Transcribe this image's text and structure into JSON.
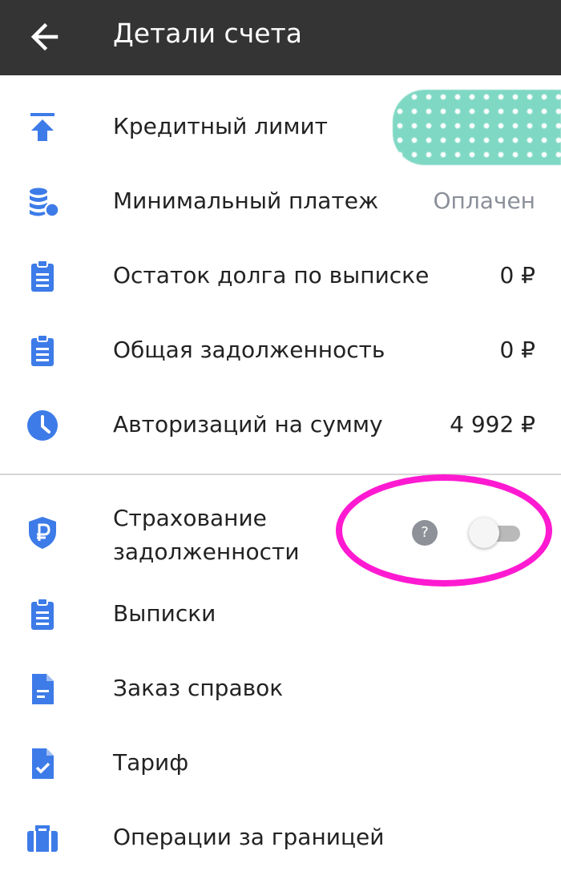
{
  "app_bar": {
    "title": "Детали счета",
    "back_icon": "arrow-back-icon"
  },
  "colors": {
    "accent": "#3d7be8",
    "app_bar": "#343434",
    "annotation": "#ff1ad1"
  },
  "rows": [
    {
      "label": "Кредитный лимит",
      "value": "",
      "icon": "arrow-up-to-line-icon"
    },
    {
      "label": "Минимальный платеж",
      "value": "Оплачен",
      "icon": "coins-stack-icon"
    },
    {
      "label": "Остаток долга по выписке",
      "value": "0 ₽",
      "icon": "clipboard-icon"
    },
    {
      "label": "Общая задолженность",
      "value": "0 ₽",
      "icon": "clipboard-icon"
    },
    {
      "label": "Авторизаций на сумму",
      "value": "4 992 ₽",
      "icon": "clock-icon"
    }
  ],
  "insurance": {
    "label": "Страхование задолженности",
    "help": "?",
    "toggle_on": false,
    "icon": "ruble-shield-icon"
  },
  "menu": [
    {
      "label": "Выписки",
      "icon": "clipboard-icon"
    },
    {
      "label": "Заказ справок",
      "icon": "document-icon"
    },
    {
      "label": "Тариф",
      "icon": "document-check-icon"
    },
    {
      "label": "Операции за границей",
      "icon": "briefcase-icon"
    }
  ]
}
